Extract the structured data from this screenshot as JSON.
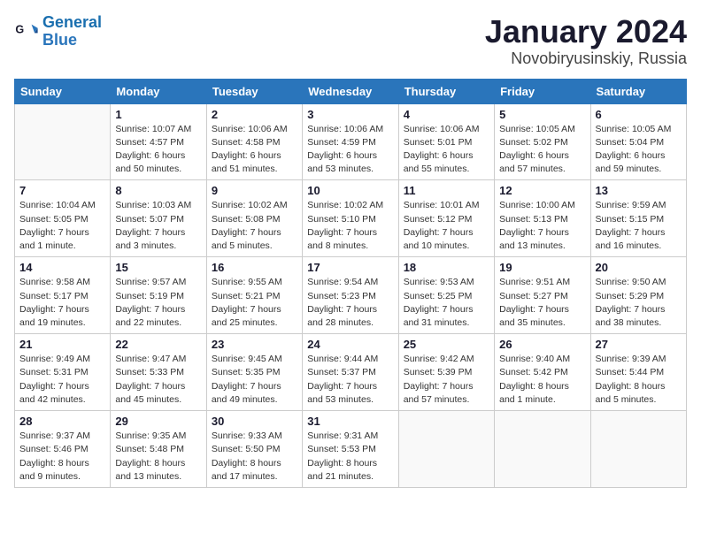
{
  "logo": {
    "line1": "General",
    "line2": "Blue"
  },
  "title": "January 2024",
  "subtitle": "Novobiryusinskiy, Russia",
  "days_of_week": [
    "Sunday",
    "Monday",
    "Tuesday",
    "Wednesday",
    "Thursday",
    "Friday",
    "Saturday"
  ],
  "weeks": [
    [
      {
        "num": "",
        "info": ""
      },
      {
        "num": "1",
        "info": "Sunrise: 10:07 AM\nSunset: 4:57 PM\nDaylight: 6 hours\nand 50 minutes."
      },
      {
        "num": "2",
        "info": "Sunrise: 10:06 AM\nSunset: 4:58 PM\nDaylight: 6 hours\nand 51 minutes."
      },
      {
        "num": "3",
        "info": "Sunrise: 10:06 AM\nSunset: 4:59 PM\nDaylight: 6 hours\nand 53 minutes."
      },
      {
        "num": "4",
        "info": "Sunrise: 10:06 AM\nSunset: 5:01 PM\nDaylight: 6 hours\nand 55 minutes."
      },
      {
        "num": "5",
        "info": "Sunrise: 10:05 AM\nSunset: 5:02 PM\nDaylight: 6 hours\nand 57 minutes."
      },
      {
        "num": "6",
        "info": "Sunrise: 10:05 AM\nSunset: 5:04 PM\nDaylight: 6 hours\nand 59 minutes."
      }
    ],
    [
      {
        "num": "7",
        "info": "Sunrise: 10:04 AM\nSunset: 5:05 PM\nDaylight: 7 hours\nand 1 minute."
      },
      {
        "num": "8",
        "info": "Sunrise: 10:03 AM\nSunset: 5:07 PM\nDaylight: 7 hours\nand 3 minutes."
      },
      {
        "num": "9",
        "info": "Sunrise: 10:02 AM\nSunset: 5:08 PM\nDaylight: 7 hours\nand 5 minutes."
      },
      {
        "num": "10",
        "info": "Sunrise: 10:02 AM\nSunset: 5:10 PM\nDaylight: 7 hours\nand 8 minutes."
      },
      {
        "num": "11",
        "info": "Sunrise: 10:01 AM\nSunset: 5:12 PM\nDaylight: 7 hours\nand 10 minutes."
      },
      {
        "num": "12",
        "info": "Sunrise: 10:00 AM\nSunset: 5:13 PM\nDaylight: 7 hours\nand 13 minutes."
      },
      {
        "num": "13",
        "info": "Sunrise: 9:59 AM\nSunset: 5:15 PM\nDaylight: 7 hours\nand 16 minutes."
      }
    ],
    [
      {
        "num": "14",
        "info": "Sunrise: 9:58 AM\nSunset: 5:17 PM\nDaylight: 7 hours\nand 19 minutes."
      },
      {
        "num": "15",
        "info": "Sunrise: 9:57 AM\nSunset: 5:19 PM\nDaylight: 7 hours\nand 22 minutes."
      },
      {
        "num": "16",
        "info": "Sunrise: 9:55 AM\nSunset: 5:21 PM\nDaylight: 7 hours\nand 25 minutes."
      },
      {
        "num": "17",
        "info": "Sunrise: 9:54 AM\nSunset: 5:23 PM\nDaylight: 7 hours\nand 28 minutes."
      },
      {
        "num": "18",
        "info": "Sunrise: 9:53 AM\nSunset: 5:25 PM\nDaylight: 7 hours\nand 31 minutes."
      },
      {
        "num": "19",
        "info": "Sunrise: 9:51 AM\nSunset: 5:27 PM\nDaylight: 7 hours\nand 35 minutes."
      },
      {
        "num": "20",
        "info": "Sunrise: 9:50 AM\nSunset: 5:29 PM\nDaylight: 7 hours\nand 38 minutes."
      }
    ],
    [
      {
        "num": "21",
        "info": "Sunrise: 9:49 AM\nSunset: 5:31 PM\nDaylight: 7 hours\nand 42 minutes."
      },
      {
        "num": "22",
        "info": "Sunrise: 9:47 AM\nSunset: 5:33 PM\nDaylight: 7 hours\nand 45 minutes."
      },
      {
        "num": "23",
        "info": "Sunrise: 9:45 AM\nSunset: 5:35 PM\nDaylight: 7 hours\nand 49 minutes."
      },
      {
        "num": "24",
        "info": "Sunrise: 9:44 AM\nSunset: 5:37 PM\nDaylight: 7 hours\nand 53 minutes."
      },
      {
        "num": "25",
        "info": "Sunrise: 9:42 AM\nSunset: 5:39 PM\nDaylight: 7 hours\nand 57 minutes."
      },
      {
        "num": "26",
        "info": "Sunrise: 9:40 AM\nSunset: 5:42 PM\nDaylight: 8 hours\nand 1 minute."
      },
      {
        "num": "27",
        "info": "Sunrise: 9:39 AM\nSunset: 5:44 PM\nDaylight: 8 hours\nand 5 minutes."
      }
    ],
    [
      {
        "num": "28",
        "info": "Sunrise: 9:37 AM\nSunset: 5:46 PM\nDaylight: 8 hours\nand 9 minutes."
      },
      {
        "num": "29",
        "info": "Sunrise: 9:35 AM\nSunset: 5:48 PM\nDaylight: 8 hours\nand 13 minutes."
      },
      {
        "num": "30",
        "info": "Sunrise: 9:33 AM\nSunset: 5:50 PM\nDaylight: 8 hours\nand 17 minutes."
      },
      {
        "num": "31",
        "info": "Sunrise: 9:31 AM\nSunset: 5:53 PM\nDaylight: 8 hours\nand 21 minutes."
      },
      {
        "num": "",
        "info": ""
      },
      {
        "num": "",
        "info": ""
      },
      {
        "num": "",
        "info": ""
      }
    ]
  ]
}
